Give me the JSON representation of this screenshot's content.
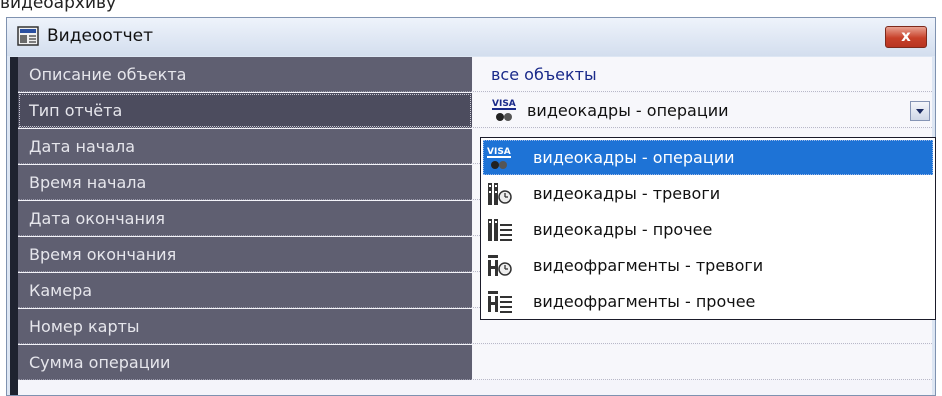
{
  "top_text": "видеоархиву",
  "window": {
    "title": "Видеоотчет",
    "close_label": "x"
  },
  "rows": [
    {
      "label": "Описание объекта",
      "value": "все объекты"
    },
    {
      "label": "Тип отчёта",
      "value": "видеокадры - операции"
    },
    {
      "label": "Дата начала",
      "value": ""
    },
    {
      "label": "Время начала",
      "value": ""
    },
    {
      "label": "Дата окончания",
      "value": ""
    },
    {
      "label": "Время окончания",
      "value": ""
    },
    {
      "label": "Камера",
      "value": ""
    },
    {
      "label": "Номер карты",
      "value": ""
    },
    {
      "label": "Сумма операции",
      "value": ""
    }
  ],
  "combo": {
    "icon": "visa-camera-icon",
    "selected": "видеокадры - операции"
  },
  "dropdown": {
    "items": [
      {
        "label": "видеокадры - операции",
        "icon": "visa-camera-icon",
        "selected": true
      },
      {
        "label": "видеокадры - тревоги",
        "icon": "frames-alarm-icon",
        "selected": false
      },
      {
        "label": "видеокадры - прочее",
        "icon": "frames-list-icon",
        "selected": false
      },
      {
        "label": "видеофрагменты - тревоги",
        "icon": "fragments-alarm-icon",
        "selected": false
      },
      {
        "label": "видеофрагменты - прочее",
        "icon": "fragments-list-icon",
        "selected": false
      }
    ]
  },
  "colors": {
    "selection": "#1e73d6",
    "label_bg": "#5f5f71",
    "value_text": "#1a2a8a"
  }
}
